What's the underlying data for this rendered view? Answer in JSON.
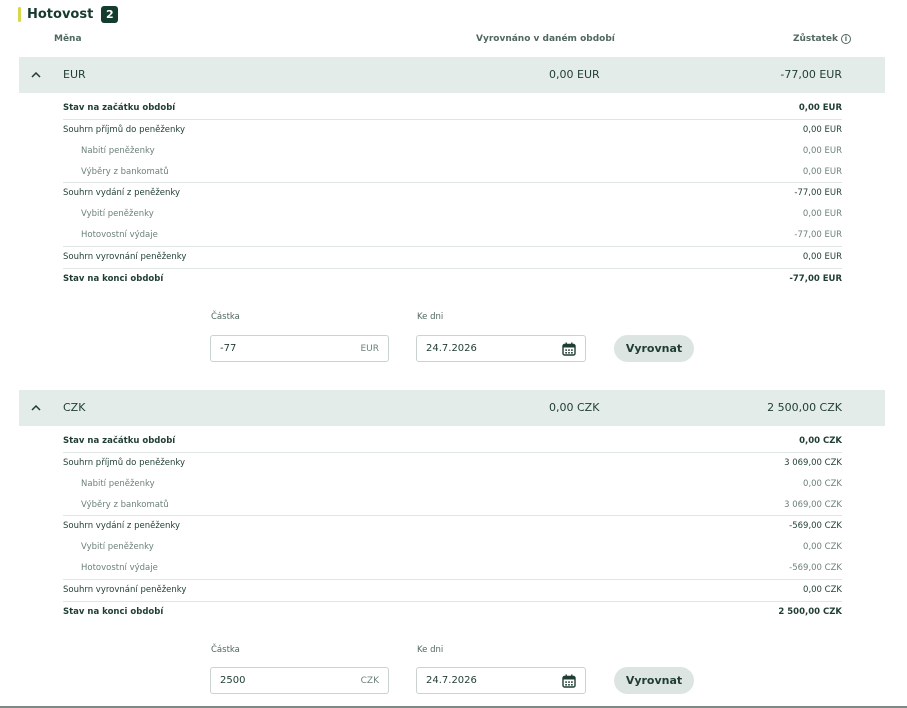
{
  "section": {
    "title": "Hotovost",
    "count": "2"
  },
  "columns": {
    "currency": "Měna",
    "settled": "Vyrovnáno v daném období",
    "balance": "Zůstatek",
    "info_glyph": "i"
  },
  "currencies": [
    {
      "name": "EUR",
      "settled": "0,00 EUR",
      "balance": "-77,00 EUR",
      "rows": [
        {
          "label": "Stav na začátku období",
          "value": "0,00 EUR"
        },
        {
          "label": "Souhrn příjmů do peněženky",
          "value": "0,00 EUR"
        },
        {
          "label": "Nabití peněženky",
          "value": "0,00 EUR"
        },
        {
          "label": "Výběry z bankomatů",
          "value": "0,00 EUR"
        },
        {
          "label": "Souhrn vydání z peněženky",
          "value": "-77,00 EUR"
        },
        {
          "label": "Vybití peněženky",
          "value": "0,00 EUR"
        },
        {
          "label": "Hotovostní výdaje",
          "value": "-77,00 EUR"
        },
        {
          "label": "Souhrn vyrovnání peněženky",
          "value": "0,00 EUR"
        },
        {
          "label": "Stav na konci období",
          "value": "-77,00 EUR"
        }
      ],
      "form": {
        "amount_label": "Částka",
        "amount_value": "-77",
        "amount_unit": "EUR",
        "date_label": "Ke dni",
        "date_value": "24.7.2026",
        "button": "Vyrovnat"
      }
    },
    {
      "name": "CZK",
      "settled": "0,00 CZK",
      "balance": "2 500,00 CZK",
      "rows": [
        {
          "label": "Stav na začátku období",
          "value": "0,00 CZK"
        },
        {
          "label": "Souhrn příjmů do peněženky",
          "value": "3 069,00 CZK"
        },
        {
          "label": "Nabití peněženky",
          "value": "0,00 CZK"
        },
        {
          "label": "Výběry z bankomatů",
          "value": "3 069,00 CZK"
        },
        {
          "label": "Souhrn vydání z peněženky",
          "value": "-569,00 CZK"
        },
        {
          "label": "Vybití peněženky",
          "value": "0,00 CZK"
        },
        {
          "label": "Hotovostní výdaje",
          "value": "-569,00 CZK"
        },
        {
          "label": "Souhrn vyrovnání peněženky",
          "value": "0,00 CZK"
        },
        {
          "label": "Stav na konci období",
          "value": "2 500,00 CZK"
        }
      ],
      "form": {
        "amount_label": "Částka",
        "amount_value": "2500",
        "amount_unit": "CZK",
        "date_label": "Ke dni",
        "date_value": "24.7.2026",
        "button": "Vyrovnat"
      }
    }
  ],
  "icons": {
    "collapse": "chevron-up-icon",
    "calendar": "calendar-icon",
    "info": "info-icon"
  },
  "colors": {
    "accent": "#d9d64a",
    "badge": "#143d30",
    "header_bg": "#e4ecea",
    "button_bg": "#dde5e2",
    "text": "#1f3d33"
  }
}
